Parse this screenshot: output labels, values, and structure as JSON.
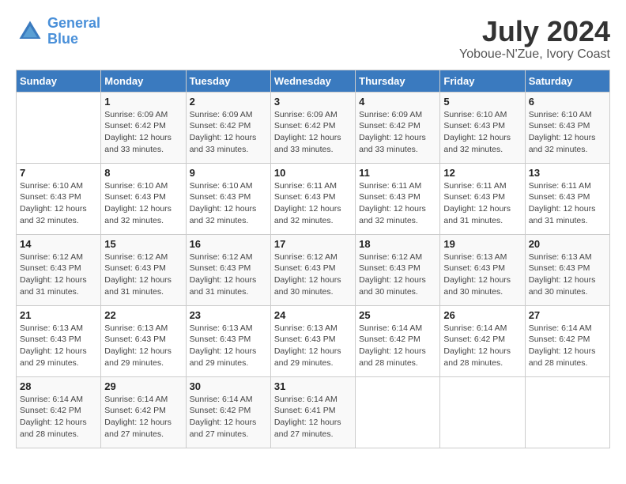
{
  "header": {
    "logo_line1": "General",
    "logo_line2": "Blue",
    "month_year": "July 2024",
    "location": "Yoboue-N'Zue, Ivory Coast"
  },
  "days_of_week": [
    "Sunday",
    "Monday",
    "Tuesday",
    "Wednesday",
    "Thursday",
    "Friday",
    "Saturday"
  ],
  "weeks": [
    [
      {
        "day": "",
        "info": ""
      },
      {
        "day": "1",
        "info": "Sunrise: 6:09 AM\nSunset: 6:42 PM\nDaylight: 12 hours\nand 33 minutes."
      },
      {
        "day": "2",
        "info": "Sunrise: 6:09 AM\nSunset: 6:42 PM\nDaylight: 12 hours\nand 33 minutes."
      },
      {
        "day": "3",
        "info": "Sunrise: 6:09 AM\nSunset: 6:42 PM\nDaylight: 12 hours\nand 33 minutes."
      },
      {
        "day": "4",
        "info": "Sunrise: 6:09 AM\nSunset: 6:42 PM\nDaylight: 12 hours\nand 33 minutes."
      },
      {
        "day": "5",
        "info": "Sunrise: 6:10 AM\nSunset: 6:43 PM\nDaylight: 12 hours\nand 32 minutes."
      },
      {
        "day": "6",
        "info": "Sunrise: 6:10 AM\nSunset: 6:43 PM\nDaylight: 12 hours\nand 32 minutes."
      }
    ],
    [
      {
        "day": "7",
        "info": "Sunrise: 6:10 AM\nSunset: 6:43 PM\nDaylight: 12 hours\nand 32 minutes."
      },
      {
        "day": "8",
        "info": "Sunrise: 6:10 AM\nSunset: 6:43 PM\nDaylight: 12 hours\nand 32 minutes."
      },
      {
        "day": "9",
        "info": "Sunrise: 6:10 AM\nSunset: 6:43 PM\nDaylight: 12 hours\nand 32 minutes."
      },
      {
        "day": "10",
        "info": "Sunrise: 6:11 AM\nSunset: 6:43 PM\nDaylight: 12 hours\nand 32 minutes."
      },
      {
        "day": "11",
        "info": "Sunrise: 6:11 AM\nSunset: 6:43 PM\nDaylight: 12 hours\nand 32 minutes."
      },
      {
        "day": "12",
        "info": "Sunrise: 6:11 AM\nSunset: 6:43 PM\nDaylight: 12 hours\nand 31 minutes."
      },
      {
        "day": "13",
        "info": "Sunrise: 6:11 AM\nSunset: 6:43 PM\nDaylight: 12 hours\nand 31 minutes."
      }
    ],
    [
      {
        "day": "14",
        "info": "Sunrise: 6:12 AM\nSunset: 6:43 PM\nDaylight: 12 hours\nand 31 minutes."
      },
      {
        "day": "15",
        "info": "Sunrise: 6:12 AM\nSunset: 6:43 PM\nDaylight: 12 hours\nand 31 minutes."
      },
      {
        "day": "16",
        "info": "Sunrise: 6:12 AM\nSunset: 6:43 PM\nDaylight: 12 hours\nand 31 minutes."
      },
      {
        "day": "17",
        "info": "Sunrise: 6:12 AM\nSunset: 6:43 PM\nDaylight: 12 hours\nand 30 minutes."
      },
      {
        "day": "18",
        "info": "Sunrise: 6:12 AM\nSunset: 6:43 PM\nDaylight: 12 hours\nand 30 minutes."
      },
      {
        "day": "19",
        "info": "Sunrise: 6:13 AM\nSunset: 6:43 PM\nDaylight: 12 hours\nand 30 minutes."
      },
      {
        "day": "20",
        "info": "Sunrise: 6:13 AM\nSunset: 6:43 PM\nDaylight: 12 hours\nand 30 minutes."
      }
    ],
    [
      {
        "day": "21",
        "info": "Sunrise: 6:13 AM\nSunset: 6:43 PM\nDaylight: 12 hours\nand 29 minutes."
      },
      {
        "day": "22",
        "info": "Sunrise: 6:13 AM\nSunset: 6:43 PM\nDaylight: 12 hours\nand 29 minutes."
      },
      {
        "day": "23",
        "info": "Sunrise: 6:13 AM\nSunset: 6:43 PM\nDaylight: 12 hours\nand 29 minutes."
      },
      {
        "day": "24",
        "info": "Sunrise: 6:13 AM\nSunset: 6:43 PM\nDaylight: 12 hours\nand 29 minutes."
      },
      {
        "day": "25",
        "info": "Sunrise: 6:14 AM\nSunset: 6:42 PM\nDaylight: 12 hours\nand 28 minutes."
      },
      {
        "day": "26",
        "info": "Sunrise: 6:14 AM\nSunset: 6:42 PM\nDaylight: 12 hours\nand 28 minutes."
      },
      {
        "day": "27",
        "info": "Sunrise: 6:14 AM\nSunset: 6:42 PM\nDaylight: 12 hours\nand 28 minutes."
      }
    ],
    [
      {
        "day": "28",
        "info": "Sunrise: 6:14 AM\nSunset: 6:42 PM\nDaylight: 12 hours\nand 28 minutes."
      },
      {
        "day": "29",
        "info": "Sunrise: 6:14 AM\nSunset: 6:42 PM\nDaylight: 12 hours\nand 27 minutes."
      },
      {
        "day": "30",
        "info": "Sunrise: 6:14 AM\nSunset: 6:42 PM\nDaylight: 12 hours\nand 27 minutes."
      },
      {
        "day": "31",
        "info": "Sunrise: 6:14 AM\nSunset: 6:41 PM\nDaylight: 12 hours\nand 27 minutes."
      },
      {
        "day": "",
        "info": ""
      },
      {
        "day": "",
        "info": ""
      },
      {
        "day": "",
        "info": ""
      }
    ]
  ]
}
